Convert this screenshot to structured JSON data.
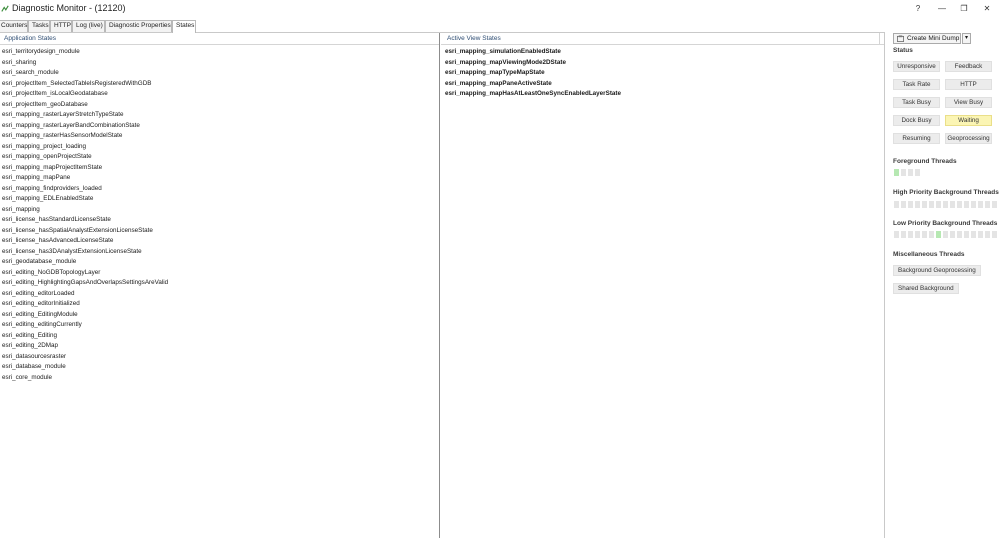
{
  "window": {
    "title": "Diagnostic Monitor - (12120)",
    "controls": {
      "help": "?",
      "minimize": "—",
      "restore": "❐",
      "close": "✕"
    }
  },
  "tabs": [
    {
      "label": "Counters",
      "active": false
    },
    {
      "label": "Tasks",
      "active": false
    },
    {
      "label": "HTTP",
      "active": false
    },
    {
      "label": "Log (live)",
      "active": false
    },
    {
      "label": "Diagnostic Properties",
      "active": false
    },
    {
      "label": "States",
      "active": true
    }
  ],
  "application_states": {
    "header": "Application States",
    "items": [
      "esri_territorydesign_module",
      "esri_sharing",
      "esri_search_module",
      "esri_projectItem_SelectedTableIsRegisteredWithGDB",
      "esri_projectItem_isLocalGeodatabase",
      "esri_projectItem_geoDatabase",
      "esri_mapping_rasterLayerStretchTypeState",
      "esri_mapping_rasterLayerBandCombinationState",
      "esri_mapping_rasterHasSensorModelState",
      "esri_mapping_project_loading",
      "esri_mapping_openProjectState",
      "esri_mapping_mapProjectItemState",
      "esri_mapping_mapPane",
      "esri_mapping_findproviders_loaded",
      "esri_mapping_EDLEnabledState",
      "esri_mapping",
      "esri_license_hasStandardLicenseState",
      "esri_license_hasSpatialAnalystExtensionLicenseState",
      "esri_license_hasAdvancedLicenseState",
      "esri_license_has3DAnalystExtensionLicenseState",
      "esri_geodatabase_module",
      "esri_editing_NoGDBTopologyLayer",
      "esri_editing_HighlightingGapsAndOverlapsSettingsAreValid",
      "esri_editing_editorLoaded",
      "esri_editing_editorInitialized",
      "esri_editing_EditingModule",
      "esri_editing_editingCurrently",
      "esri_editing_Editing",
      "esri_editing_2DMap",
      "esri_datasourcesraster",
      "esri_database_module",
      "esri_core_module"
    ]
  },
  "active_view_states": {
    "header": "Active View States",
    "items": [
      "esri_mapping_simulationEnabledState",
      "esri_mapping_mapViewingMode2DState",
      "esri_mapping_mapTypeMapState",
      "esri_mapping_mapPaneActiveState",
      "esri_mapping_mapHasAtLeastOneSyncEnabledLayerState"
    ]
  },
  "side_panel": {
    "create_dump_label": "Create Mini Dump",
    "dropdown_glyph": "▾",
    "status_heading": "Status",
    "status_buttons": [
      {
        "label": "Unresponsive",
        "active": false
      },
      {
        "label": "Feedback",
        "active": false
      },
      {
        "label": "Task Rate",
        "active": false
      },
      {
        "label": "HTTP",
        "active": false
      },
      {
        "label": "Task Busy",
        "active": false
      },
      {
        "label": "View Busy",
        "active": false
      },
      {
        "label": "Dock Busy",
        "active": false
      },
      {
        "label": "Waiting",
        "active": true,
        "color": "#fbf5b4"
      },
      {
        "label": "Resuming",
        "active": false
      },
      {
        "label": "Geoprocessing",
        "active": false
      }
    ],
    "foreground_threads_heading": "Foreground Threads",
    "foreground_threads": [
      1,
      0,
      0,
      0
    ],
    "high_priority_heading": "High Priority Background Threads",
    "high_priority_threads": [
      0,
      0,
      0,
      0,
      0,
      0,
      0,
      0,
      0,
      0,
      0,
      0,
      0,
      0,
      0,
      0
    ],
    "low_priority_heading": "Low Priority Background Threads",
    "low_priority_threads": [
      0,
      0,
      0,
      0,
      0,
      0,
      1,
      0,
      0,
      0,
      0,
      0,
      0,
      0,
      0,
      0
    ],
    "misc_heading": "Miscellaneous Threads",
    "misc_buttons": [
      "Background Geoprocessing",
      "Shared Background"
    ],
    "thread_active_color": "#b6e8b2"
  }
}
